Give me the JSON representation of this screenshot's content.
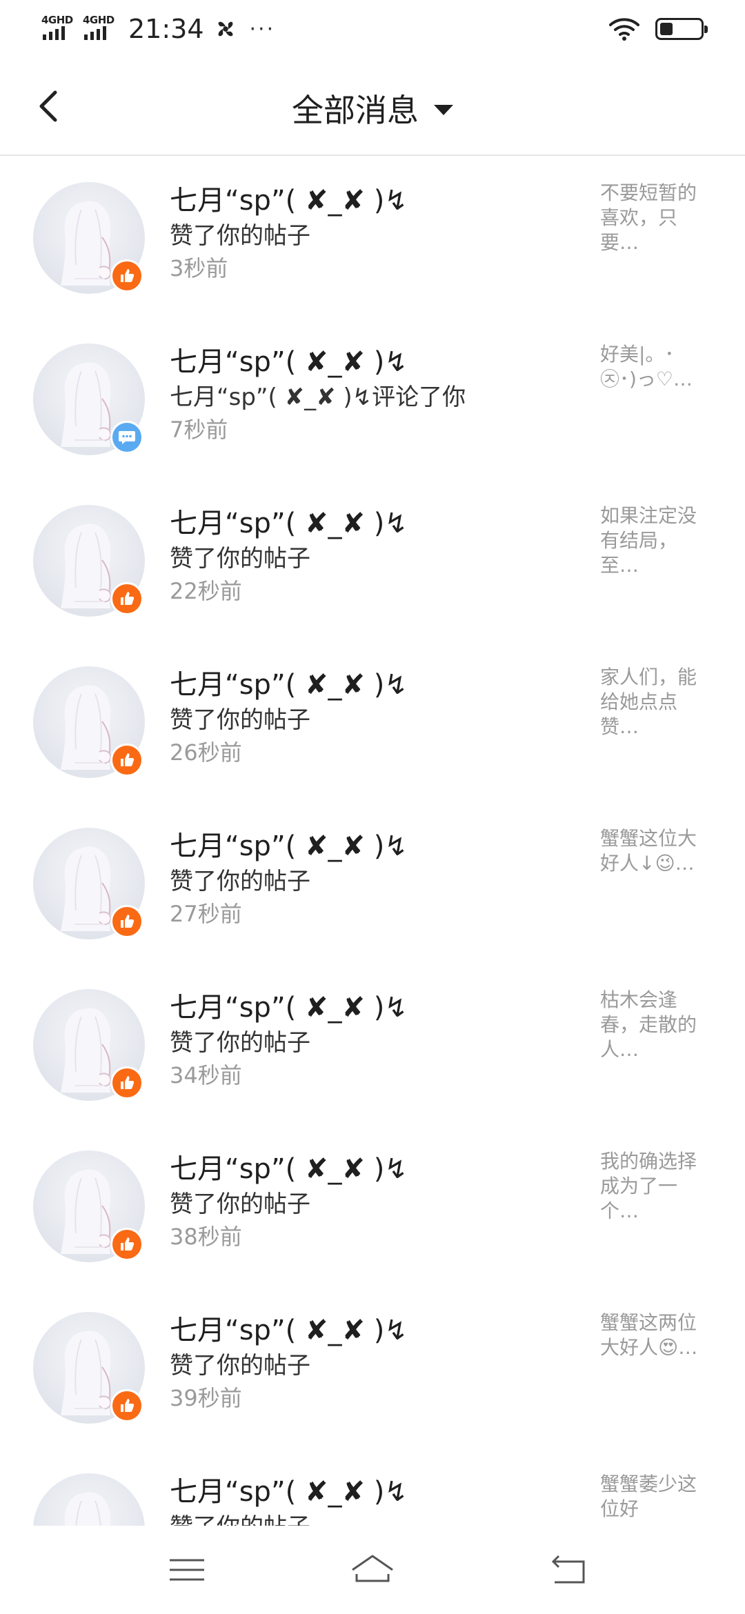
{
  "status_bar": {
    "net1": "4GHD",
    "net2": "4GHD",
    "time": "21:34",
    "dots": "···"
  },
  "header": {
    "title": "全部消息"
  },
  "messages": [
    {
      "name": "七月“sp”( ✘_✘ )↯",
      "action": "赞了你的帖子",
      "time": "3秒前",
      "preview": "不要短暂的喜欢，只要…",
      "type": "like"
    },
    {
      "name": "七月“sp”( ✘_✘ )↯",
      "action": "七月“sp”( ✘_✘ )↯评论了你",
      "time": "7秒前",
      "preview": "好美|。･㉨･)っ♡…",
      "type": "comment"
    },
    {
      "name": "七月“sp”( ✘_✘ )↯",
      "action": "赞了你的帖子",
      "time": "22秒前",
      "preview": "如果注定没有结局，至…",
      "type": "like"
    },
    {
      "name": "七月“sp”( ✘_✘ )↯",
      "action": "赞了你的帖子",
      "time": "26秒前",
      "preview": "家人们，能给她点点赞…",
      "type": "like"
    },
    {
      "name": "七月“sp”( ✘_✘ )↯",
      "action": "赞了你的帖子",
      "time": "27秒前",
      "preview": "蟹蟹这位大好人↓😉…",
      "type": "like"
    },
    {
      "name": "七月“sp”( ✘_✘ )↯",
      "action": "赞了你的帖子",
      "time": "34秒前",
      "preview": "枯木会逢春，走散的人…",
      "type": "like"
    },
    {
      "name": "七月“sp”( ✘_✘ )↯",
      "action": "赞了你的帖子",
      "time": "38秒前",
      "preview": "我的确选择成为了一个…",
      "type": "like"
    },
    {
      "name": "七月“sp”( ✘_✘ )↯",
      "action": "赞了你的帖子",
      "time": "39秒前",
      "preview": "蟹蟹这两位大好人😍…",
      "type": "like"
    },
    {
      "name": "七月“sp”( ✘_✘ )↯",
      "action": "赞了你的帖子",
      "time": "",
      "preview": "蟹蟹萎少这位好",
      "type": "like"
    }
  ],
  "icons": {
    "back": "back-chevron-icon",
    "dropdown": "caret-down-icon",
    "like_badge": "thumbs-up-icon",
    "comment_badge": "chat-bubble-icon",
    "nav_menu": "menu-icon",
    "nav_home": "home-icon",
    "nav_back": "return-icon"
  },
  "colors": {
    "like_badge": "#fa6a14",
    "comment_badge": "#5aaaf2",
    "secondary_text": "#9a9a9a"
  }
}
